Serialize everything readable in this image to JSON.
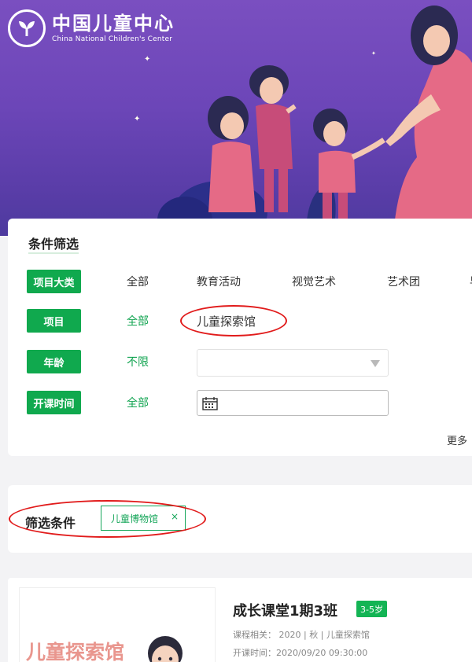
{
  "brand": {
    "name_cn": "中国儿童中心",
    "name_en": "China National Children's Center"
  },
  "filter": {
    "title": "条件筛选",
    "rows": [
      {
        "tag": "项目大类",
        "options": [
          "全部",
          "教育活动",
          "视觉艺术",
          "艺术团",
          "早"
        ]
      },
      {
        "tag": "项目",
        "options": [
          "全部",
          "儿童探索馆"
        ]
      },
      {
        "tag": "年龄",
        "options": [
          "不限"
        ]
      },
      {
        "tag": "开课时间",
        "options": [
          "全部"
        ]
      }
    ],
    "age_select_value": "",
    "date_value": "",
    "more_label": "更多"
  },
  "conditions": {
    "title": "筛选条件",
    "chip_label": "儿童博物馆",
    "chip_close": "×"
  },
  "course": {
    "thumb_text": "儿童探索馆",
    "title": "成长课堂1期3班",
    "age_badge": "3-5岁",
    "related": "课程相关： 2020 | 秋 | 儿童探索馆",
    "start_time": "开课时间：2020/09/20 09:30:00"
  },
  "colors": {
    "accent_green": "#10a94e",
    "hero_purple": "#6c46b8",
    "annotation_red": "#e11b1b"
  }
}
